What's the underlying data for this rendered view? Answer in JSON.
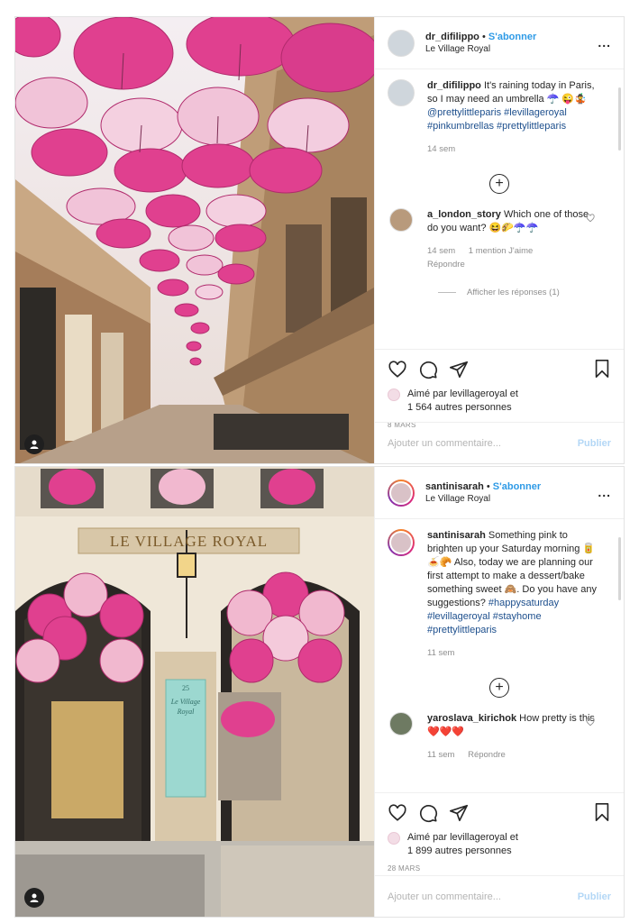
{
  "posts": [
    {
      "username": "dr_difilippo",
      "separator": "•",
      "follow_label": "S'abonner",
      "location": "Le Village Royal",
      "more_label": "...",
      "caption": {
        "username": "dr_difilippo",
        "text": "It's raining today in Paris, so I may need an umbrella ☂️ 😜🤹 ",
        "mention": "@prettylittleparis",
        "hashtags": "#levillageroyal #pinkumbrellas #prettylittleparis",
        "time": "14 sem"
      },
      "comment": {
        "username": "a_london_story",
        "text": "Which one of those do you want? 😆🌮☂️☂️",
        "time": "14 sem",
        "likes": "1 mention J'aime",
        "reply": "Répondre",
        "view_replies": "Afficher les réponses (1)"
      },
      "liked_by": "Aimé par levillageroyal et",
      "liked_count": "1 564 autres personnes",
      "date": "8 MARS",
      "comment_placeholder": "Ajouter un commentaire...",
      "publish_label": "Publier"
    },
    {
      "username": "santinisarah",
      "separator": "•",
      "follow_label": "S'abonner",
      "location": "Le Village Royal",
      "more_label": "...",
      "caption": {
        "username": "santinisarah",
        "text": "Something pink to brighten up your Saturday morning 🥫🍝🥐 Also, today we are planning our first attempt to make a dessert/bake something sweet 🙈. Do you have any suggestions?",
        "hashtags": "#happysaturday #levillageroyal #stayhome #prettylittleparis",
        "time": "11 sem"
      },
      "comment": {
        "username": "yaroslava_kirichok",
        "text": "How pretty is this ❤️❤️❤️",
        "time": "11 sem",
        "reply": "Répondre"
      },
      "liked_by": "Aimé par levillageroyal et",
      "liked_count": "1 899 autres personnes",
      "date": "28 MARS",
      "comment_placeholder": "Ajouter un commentaire...",
      "publish_label": "Publier"
    }
  ],
  "photo2_sign": {
    "arch_text": "LE VILLAGE ROYAL",
    "plaque_number": "25",
    "plaque_title": "Le Village Royal"
  },
  "colors": {
    "link_blue": "#2e9ae6",
    "hashtag_blue": "#1d4f8d",
    "publish_disabled": "#b3d7f6",
    "meta_gray": "#8e8e8e",
    "umbrella_pink": "#e0408f"
  },
  "icons": [
    "heart-icon",
    "comment-icon",
    "share-icon",
    "bookmark-icon",
    "add-icon",
    "person-icon",
    "more-icon"
  ]
}
